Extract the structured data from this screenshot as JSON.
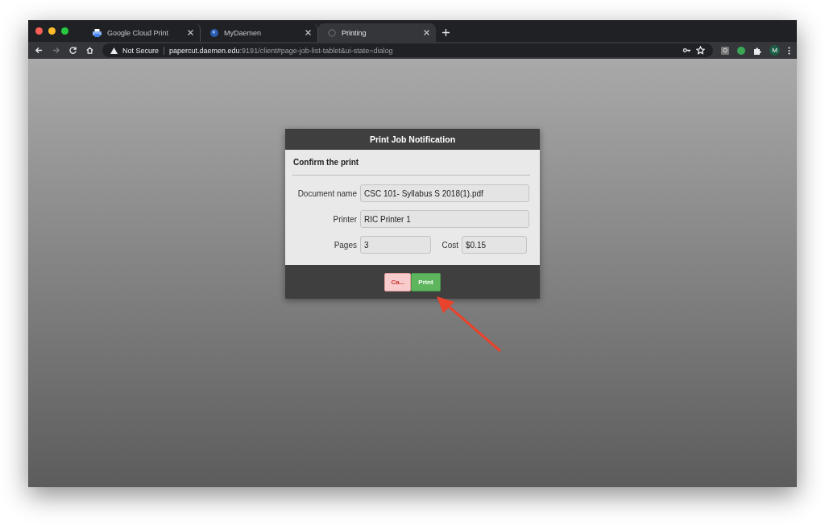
{
  "browser": {
    "tabs": [
      {
        "title": "Google Cloud Print",
        "selected": false
      },
      {
        "title": "MyDaemen",
        "selected": false
      },
      {
        "title": "Printing",
        "selected": true
      }
    ],
    "security_label": "Not Secure",
    "url_host": "papercut.daemen.edu",
    "url_rest": ":9191/client#page-job-list-tablet&ui-state=dialog",
    "profile_initial": "M"
  },
  "dialog": {
    "title": "Print Job Notification",
    "heading": "Confirm the print",
    "fields": [
      {
        "label": "Document name",
        "value": "CSC 101- Syllabus S 2018(1).pdf"
      },
      {
        "label": "Printer",
        "value": "RIC Printer 1"
      },
      {
        "label": "Pages",
        "value": "3"
      },
      {
        "label": "Cost",
        "value": "$0.15"
      }
    ],
    "buttons": [
      {
        "label": "Ca...",
        "kind": "cancel"
      },
      {
        "label": "Print",
        "kind": "confirm"
      }
    ]
  }
}
